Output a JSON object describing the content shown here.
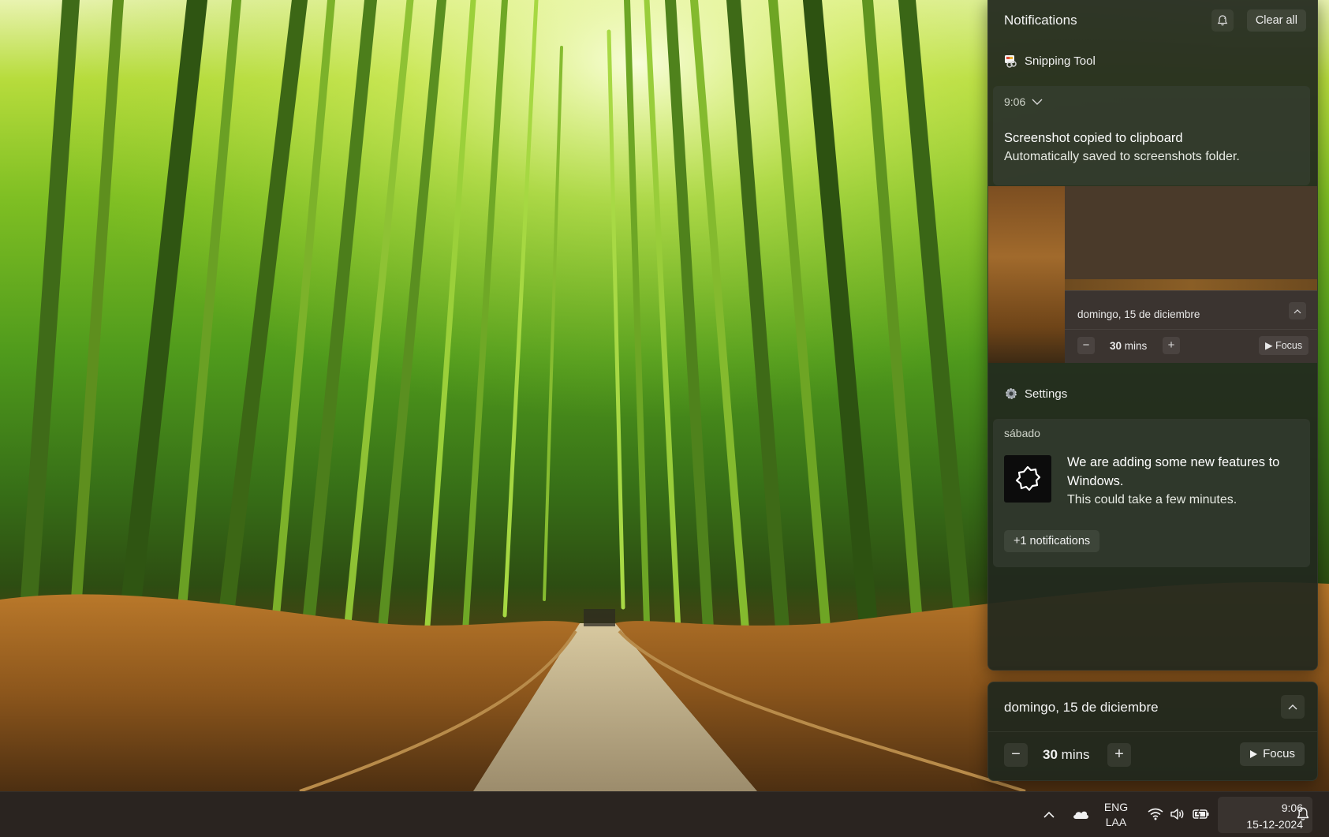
{
  "notification_center": {
    "title": "Notifications",
    "clear_all_label": "Clear all",
    "groups": [
      {
        "app_name": "Snipping Tool",
        "notification": {
          "time": "9:06",
          "title": "Screenshot copied to clipboard",
          "body": "Automatically saved to screenshots folder."
        },
        "thumbnail_focus": {
          "date": "domingo, 15 de diciembre",
          "minutes_value": "30",
          "minutes_unit": "mins",
          "focus_label": "Focus"
        }
      },
      {
        "app_name": "Settings",
        "notification": {
          "time": "sábado",
          "title_line1": "We are adding some new features to",
          "title_line2": "Windows.",
          "body": "This could take a few minutes."
        },
        "more_label": "+1 notifications"
      }
    ]
  },
  "focus_panel": {
    "date": "domingo, 15 de diciembre",
    "minutes_value": "30",
    "minutes_unit": "mins",
    "focus_label": "Focus"
  },
  "taskbar": {
    "lang_line1": "ENG",
    "lang_line2": "LAA",
    "time": "9:06",
    "date": "15-12-2024",
    "icons": [
      "chevron-up-icon",
      "onedrive-cloud-icon",
      "wifi-icon",
      "volume-icon",
      "battery-icon",
      "bell-icon"
    ]
  },
  "colors": {
    "panel_bg": "#21281e",
    "taskbar_bg": "#2a2420"
  }
}
